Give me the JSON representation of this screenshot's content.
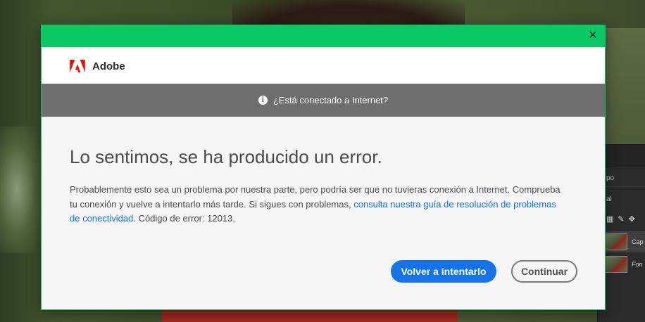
{
  "dialog": {
    "brand_name": "Adobe",
    "info_text": "¿Está conectado a Internet?",
    "title": "Lo sentimos, se ha producido un error.",
    "body_part1": "Probablemente esto sea un problema por nuestra parte, pero podría ser que no tuvieras conexión a Internet. Comprueba tu conexión y vuelve a intentarlo más tarde. Si sigues con problemas, ",
    "body_link": "consulta nuestra guía de resolución de problemas de conectividad",
    "body_part2": ". Código de error: 12013.",
    "retry_label": "Volver a intentarlo",
    "continue_label": "Continuar",
    "close_glyph": "✕",
    "colors": {
      "titlebar": "#0ac863",
      "info_bar": "#6e6e6e",
      "primary_button": "#1473e6",
      "link": "#1473e6",
      "adobe_red": "#eb1000"
    }
  },
  "photoshop_panel": {
    "tab_fragment": "po",
    "mode_fragment": "al",
    "layers": [
      {
        "name_fragment": "Cap"
      },
      {
        "name_fragment": "Fon"
      }
    ]
  }
}
